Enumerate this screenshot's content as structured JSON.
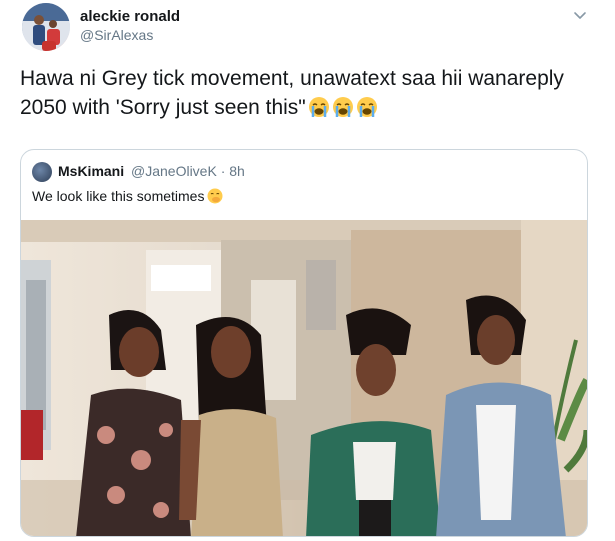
{
  "tweet": {
    "author_name": "aleckie ronald",
    "author_handle": "@SirAlexas",
    "text": "Hawa ni Grey tick movement, unawatext saa hii wanareply 2050 with 'Sorry just seen this\"",
    "emojis": [
      "loudly-crying-face",
      "loudly-crying-face",
      "loudly-crying-face"
    ]
  },
  "quoted_tweet": {
    "author_name": "MsKimani",
    "author_handle": "@JaneOliveK",
    "separator": "·",
    "time": "8h",
    "text": "We look like this sometimes",
    "emoji": "face-with-hand-over-mouth",
    "photo": {
      "subject": "four-women-posing-indoors",
      "colors": {
        "wall": "#d9c8b4",
        "floor": "#bfae98",
        "jacket": "#2b6e59",
        "denim": "#7b96b5",
        "dress": "#3b2a28",
        "skirt": "#c9b089"
      }
    }
  },
  "colors": {
    "text": "#14171a",
    "secondary": "#657786",
    "border": "#ccd6dd"
  }
}
